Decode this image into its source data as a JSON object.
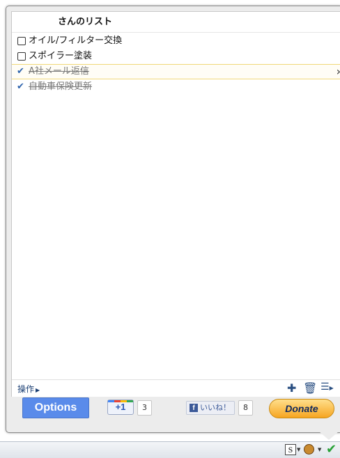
{
  "list": {
    "title": "さんのリスト",
    "tasks": [
      {
        "label": "オイル/フィルター交換",
        "completed": false
      },
      {
        "label": "スポイラー塗装",
        "completed": false
      },
      {
        "label": "A社メール返信",
        "completed": true,
        "selected": true
      },
      {
        "label": "自動車保険更新",
        "completed": true
      }
    ]
  },
  "toolbar": {
    "actions_label": "操作",
    "add_icon": "plus-icon",
    "delete_icon": "trash-icon",
    "list_menu_icon": "list-menu-icon"
  },
  "footer": {
    "options_label": "Options",
    "gplus_label": "+1",
    "gplus_count": "3",
    "fb_like_label": "いいね！",
    "fb_like_count": "8",
    "donate_label": "Donate"
  },
  "statusbar": {
    "icons": [
      "s-icon",
      "monkey-icon",
      "green-check-icon"
    ]
  },
  "colors": {
    "options_button": "#5a8bea",
    "check_mark": "#2d63ad",
    "selected_border": "#f0d778",
    "donate_button": "#f6a521"
  }
}
